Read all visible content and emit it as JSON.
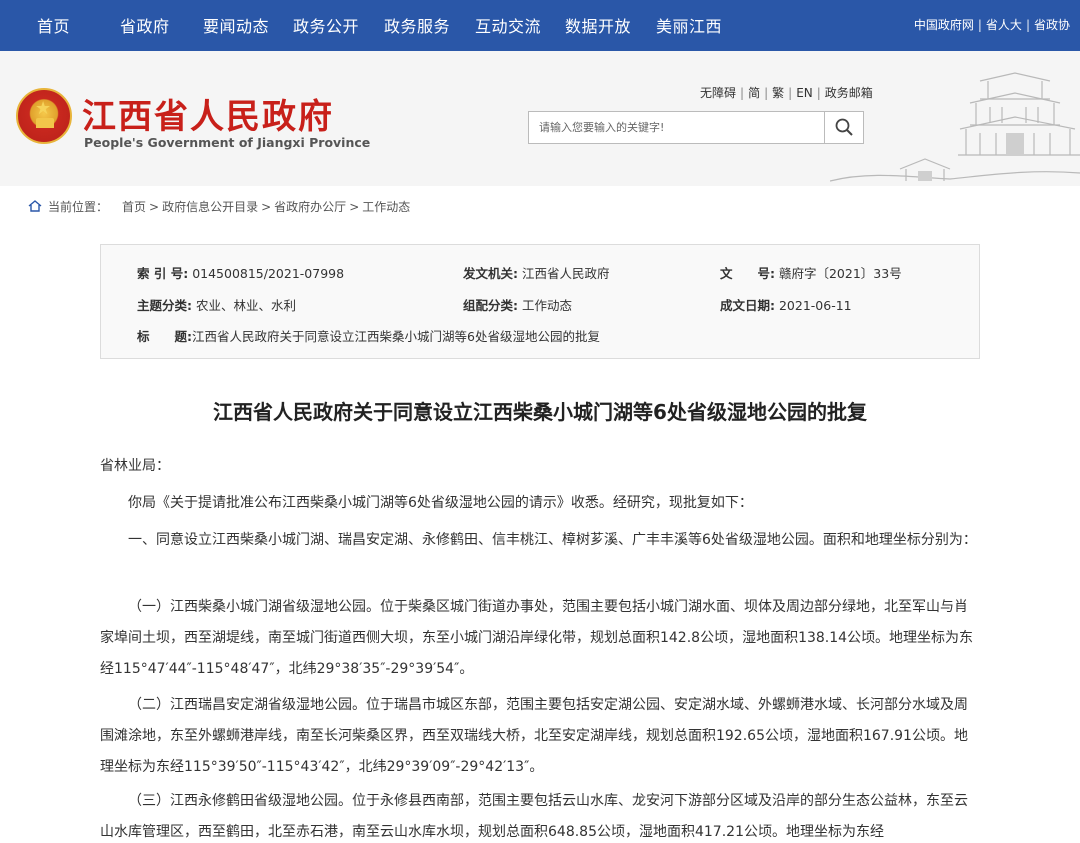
{
  "topnav": {
    "items": [
      "首页",
      "省政府",
      "要闻动态",
      "政务公开",
      "政务服务",
      "互动交流",
      "数据开放",
      "美丽江西"
    ],
    "links": [
      "中国政府网",
      "省人大",
      "省政协"
    ]
  },
  "header": {
    "site_title": "江西省人民政府",
    "site_subtitle": "People's Government of Jiangxi Province",
    "access_links": [
      "无障碍",
      "简",
      "繁",
      "EN",
      "政务邮箱"
    ],
    "search_placeholder": "请输入您要输入的关键字!"
  },
  "breadcrumb": {
    "label": "当前位置：",
    "items": [
      "首页",
      "政府信息公开目录",
      "省政府办公厅",
      "工作动态"
    ]
  },
  "info": {
    "index_key": "索 引 号:",
    "index_val": "014500815/2021-07998",
    "issuer_key": "发文机关:",
    "issuer_val": "江西省人民政府",
    "docno_key": "文　　号:",
    "docno_val": "赣府字〔2021〕33号",
    "topic_key": "主题分类:",
    "topic_val": "农业、林业、水利",
    "category_key": "组配分类:",
    "category_val": "工作动态",
    "date_key": "成文日期:",
    "date_val": "2021-06-11",
    "title_key": "标　　题:",
    "title_val": "江西省人民政府关于同意设立江西柴桑小城门湖等6处省级湿地公园的批复"
  },
  "article": {
    "title": "江西省人民政府关于同意设立江西柴桑小城门湖等6处省级湿地公园的批复",
    "addressee": "省林业局：",
    "p1": "你局《关于提请批准公布江西柴桑小城门湖等6处省级湿地公园的请示》收悉。经研究，现批复如下：",
    "p2": "一、同意设立江西柴桑小城门湖、瑞昌安定湖、永修鹤田、信丰桃江、樟树芗溪、广丰丰溪等6处省级湿地公园。面积和地理坐标分别为：",
    "p3": "（一）江西柴桑小城门湖省级湿地公园。位于柴桑区城门街道办事处，范围主要包括小城门湖水面、坝体及周边部分绿地，北至军山与肖家埠间土坝，西至湖堤线，南至城门街道西侧大坝，东至小城门湖沿岸绿化带，规划总面积142.8公顷，湿地面积138.14公顷。地理坐标为东经115°47′44″-115°48′47″，北纬29°38′35″-29°39′54″。",
    "p4": "（二）江西瑞昌安定湖省级湿地公园。位于瑞昌市城区东部，范围主要包括安定湖公园、安定湖水域、外螺蛳港水域、长河部分水域及周围滩涂地，东至外螺蛳港岸线，南至长河柴桑区界，西至双瑞线大桥，北至安定湖岸线，规划总面积192.65公顷，湿地面积167.91公顷。地理坐标为东经115°39′50″-115°43′42″，北纬29°39′09″-29°42′13″。",
    "p5": "（三）江西永修鹤田省级湿地公园。位于永修县西南部，范围主要包括云山水库、龙安河下游部分区域及沿岸的部分生态公益林，东至云山水库管理区，西至鹤田，北至赤石港，南至云山水库水坝，规划总面积648.85公顷，湿地面积417.21公顷。地理坐标为东经"
  },
  "colors": {
    "nav_bg": "#2a57a8",
    "title_red": "#c8201a"
  }
}
